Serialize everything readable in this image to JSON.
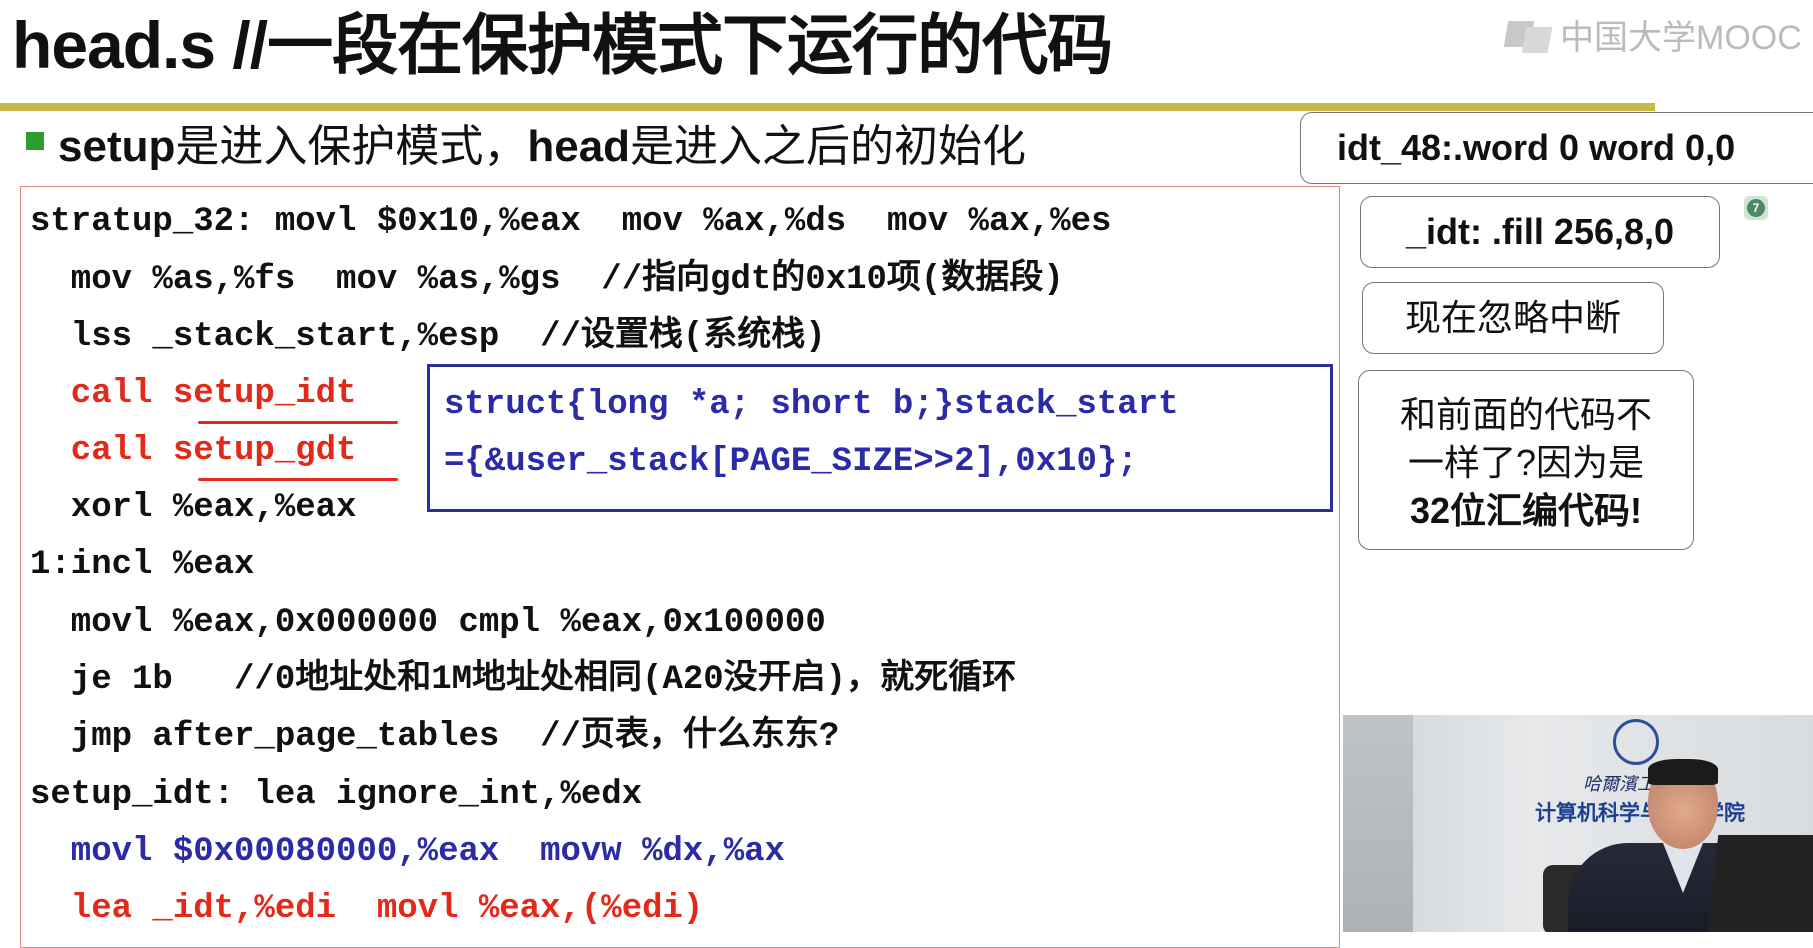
{
  "slide": {
    "title": "head.s //一段在保护模式下运行的代码",
    "logo_text": "中国大学MOOC",
    "bullet": {
      "keyword1": "setup",
      "text1": "是进入保护模式，",
      "keyword2": "head",
      "text2": "是进入之后的初始化"
    },
    "code_lines": [
      "stratup_32: movl $0x10,%eax  mov %ax,%ds  mov %ax,%es",
      "  mov %as,%fs  mov %as,%gs  //指向gdt的0x10项(数据段)",
      "  lss _stack_start,%esp  //设置栈(系统栈)",
      "  call setup_idt",
      "  call setup_gdt",
      "  xorl %eax,%eax",
      "1:incl %eax",
      "  movl %eax,0x000000 cmpl %eax,0x100000",
      "  je 1b   //0地址处和1M地址处相同(A20没开启)，就死循环",
      "  jmp after_page_tables  //页表，什么东东?",
      "setup_idt: lea ignore_int,%edx",
      "  movl $0x00080000,%eax  movw %dx,%ax",
      "  lea _idt,%edi  movl %eax,(%edi)"
    ],
    "struct_box": {
      "line1": "struct{long *a; short b;}stack_start",
      "line2": "={&user_stack[PAGE_SIZE>>2],0x10};"
    },
    "side_notes": {
      "idt48": "idt_48:.word 0  word 0,0",
      "idt": "_idt: .fill 256,8,0",
      "ignore": "现在忽略中断",
      "diff_line1": "和前面的代码不",
      "diff_line2": "一样了?因为是",
      "diff_line3": "32位汇编代码!"
    },
    "badge": "7",
    "video": {
      "caption": "计算机科学与技术学院",
      "school_text": "哈爾濱工業大學"
    }
  }
}
